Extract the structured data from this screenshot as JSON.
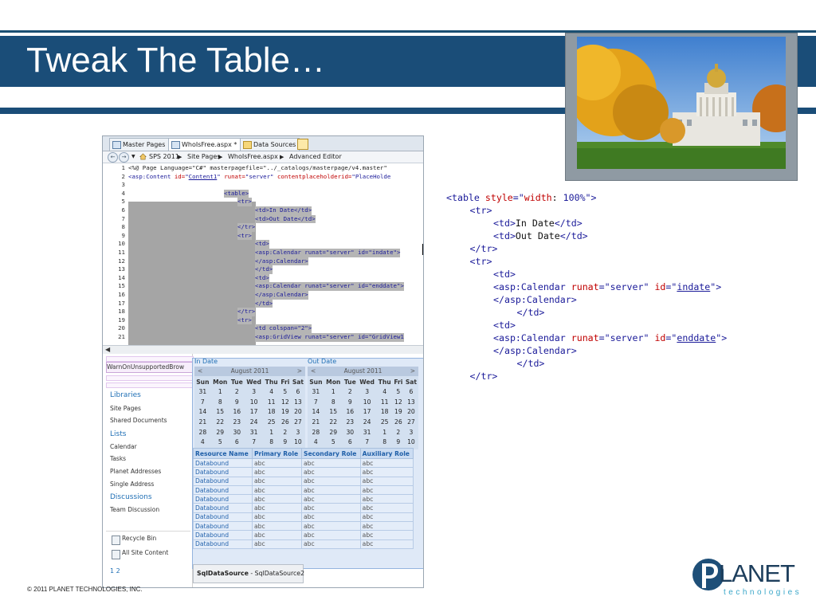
{
  "slide": {
    "title": "Tweak The Table…",
    "copyright": "© 2011  PLANET  TECHNOLOGIES,  INC.",
    "logo": {
      "letter": "P",
      "name": "LANET",
      "tagline": "technologies"
    },
    "colors": {
      "bar": "#1a4d78",
      "accent": "#3aa7c9"
    }
  },
  "editor": {
    "tabs": [
      {
        "label": "Master Pages",
        "icon": "master-pages-icon"
      },
      {
        "label": "WhoIsFree.aspx *",
        "icon": "aspx-file-icon"
      },
      {
        "label": "Data Sources",
        "icon": "data-sources-icon"
      }
    ],
    "breadcrumb": [
      "SPS 2011",
      "Site Pages",
      "WhoIsFree.aspx",
      "Advanced Editor"
    ],
    "code_lines": [
      {
        "n": "1",
        "text": "<%@ Page Language=\"C#\" masterpagefile=\"../_catalogs/masterpage/v4.master\""
      },
      {
        "n": "2",
        "a": "<asp:Content ",
        "b": "id=",
        "c": "\"",
        "d": "Content1",
        "e": "\" ",
        "f": "runat=",
        "g": "\"server\" ",
        "h": "contentplaceholderid=",
        "i": "\"PlaceHolde"
      },
      {
        "n": "3",
        "text": ""
      },
      {
        "n": "4",
        "text": "<table>"
      },
      {
        "n": "5",
        "text": "<tr>"
      },
      {
        "n": "6",
        "text": "<td>In Date</td>"
      },
      {
        "n": "7",
        "text": "<td>Out Date</td>"
      },
      {
        "n": "8",
        "text": "</tr>"
      },
      {
        "n": "9",
        "text": "<tr>"
      },
      {
        "n": "10",
        "text": "<td>"
      },
      {
        "n": "11",
        "text": "<asp:Calendar runat=\"server\" id=\"indate\">"
      },
      {
        "n": "12",
        "text": "</asp:Calendar>"
      },
      {
        "n": "13",
        "text": "</td>"
      },
      {
        "n": "14",
        "text": "<td>"
      },
      {
        "n": "15",
        "text": "<asp:Calendar runat=\"server\" id=\"enddate\">"
      },
      {
        "n": "16",
        "text": "</asp:Calendar>"
      },
      {
        "n": "17",
        "text": "</td>"
      },
      {
        "n": "18",
        "text": "</tr>"
      },
      {
        "n": "19",
        "text": "<tr>"
      },
      {
        "n": "20",
        "text": "<td colspan=\"2\">"
      },
      {
        "n": "21",
        "text": "<asp:GridView runat=\"server\" id=\"GridView1"
      }
    ]
  },
  "design": {
    "warn_label": "WarnOnUnsupportedBrow",
    "quick_launch": [
      {
        "label": "Libraries",
        "heading": true
      },
      {
        "label": "Site Pages",
        "heading": false
      },
      {
        "label": "Shared Documents",
        "heading": false
      },
      {
        "label": "Lists",
        "heading": true
      },
      {
        "label": "Calendar",
        "heading": false
      },
      {
        "label": "Tasks",
        "heading": false
      },
      {
        "label": "Planet Addresses",
        "heading": false
      },
      {
        "label": "Single Address",
        "heading": false
      },
      {
        "label": "Discussions",
        "heading": true
      },
      {
        "label": "Team Discussion",
        "heading": false
      }
    ],
    "recycle_bin": "Recycle Bin",
    "all_site_content": "All Site Content",
    "in_date_label": "In Date",
    "out_date_label": "Out Date",
    "calendar": {
      "month": "August 2011",
      "prev": "<",
      "next": ">",
      "days": [
        "Sun",
        "Mon",
        "Tue",
        "Wed",
        "Thu",
        "Fri",
        "Sat"
      ],
      "weeks": [
        [
          "31",
          "1",
          "2",
          "3",
          "4",
          "5",
          "6"
        ],
        [
          "7",
          "8",
          "9",
          "10",
          "11",
          "12",
          "13"
        ],
        [
          "14",
          "15",
          "16",
          "17",
          "18",
          "19",
          "20"
        ],
        [
          "21",
          "22",
          "23",
          "24",
          "25",
          "26",
          "27"
        ],
        [
          "28",
          "29",
          "30",
          "31",
          "1",
          "2",
          "3"
        ],
        [
          "4",
          "5",
          "6",
          "7",
          "8",
          "9",
          "10"
        ]
      ]
    },
    "grid": {
      "columns": [
        "Resource Name",
        "Primary Role",
        "Secondary Role",
        "Auxiliary Role"
      ],
      "row": [
        "Databound",
        "abc",
        "abc",
        "abc"
      ],
      "row_count": 10,
      "pager": "1 2"
    },
    "sql_source": {
      "bold": "SqlDataSource",
      "rest": " - SqlDataSource2"
    }
  },
  "snippet": [
    {
      "indent": 0,
      "parts": [
        [
          "t",
          "<table "
        ],
        [
          "n",
          "style"
        ],
        [
          "t",
          "=\""
        ],
        [
          "n",
          "width"
        ],
        [
          "x",
          ": "
        ],
        [
          "t",
          "100%"
        ],
        [
          "t",
          "\">"
        ]
      ]
    },
    {
      "indent": 1,
      "parts": [
        [
          "t",
          "<tr>"
        ]
      ]
    },
    {
      "indent": 2,
      "parts": [
        [
          "t",
          "<td>"
        ],
        [
          "x",
          "In Date"
        ],
        [
          "t",
          "</td>"
        ]
      ]
    },
    {
      "indent": 2,
      "parts": [
        [
          "t",
          "<td>"
        ],
        [
          "x",
          "Out Date"
        ],
        [
          "t",
          "</td>"
        ]
      ]
    },
    {
      "indent": 1,
      "parts": [
        [
          "t",
          "</tr>"
        ]
      ]
    },
    {
      "indent": 1,
      "parts": [
        [
          "t",
          "<tr>"
        ]
      ]
    },
    {
      "indent": 2,
      "parts": [
        [
          "t",
          "<td>"
        ]
      ]
    },
    {
      "indent": 2,
      "parts": [
        [
          "t",
          "<asp:Calendar "
        ],
        [
          "n",
          "runat"
        ],
        [
          "t",
          "=\"server\" "
        ],
        [
          "n",
          "id"
        ],
        [
          "t",
          "=\""
        ],
        [
          "u",
          "indate"
        ],
        [
          "t",
          "\">"
        ]
      ]
    },
    {
      "indent": 2,
      "parts": [
        [
          "t",
          "</asp:Calendar>"
        ]
      ]
    },
    {
      "indent": 3,
      "parts": [
        [
          "t",
          "</td>"
        ]
      ]
    },
    {
      "indent": 2,
      "parts": [
        [
          "t",
          "<td>"
        ]
      ]
    },
    {
      "indent": 2,
      "parts": [
        [
          "t",
          "<asp:Calendar "
        ],
        [
          "n",
          "runat"
        ],
        [
          "t",
          "=\"server\" "
        ],
        [
          "n",
          "id"
        ],
        [
          "t",
          "=\""
        ],
        [
          "u",
          "enddate"
        ],
        [
          "t",
          "\">"
        ]
      ]
    },
    {
      "indent": 2,
      "parts": [
        [
          "t",
          "</asp:Calendar>"
        ]
      ]
    },
    {
      "indent": 3,
      "parts": [
        [
          "t",
          "</td>"
        ]
      ]
    },
    {
      "indent": 1,
      "parts": [
        [
          "t",
          "</tr>"
        ]
      ]
    }
  ]
}
